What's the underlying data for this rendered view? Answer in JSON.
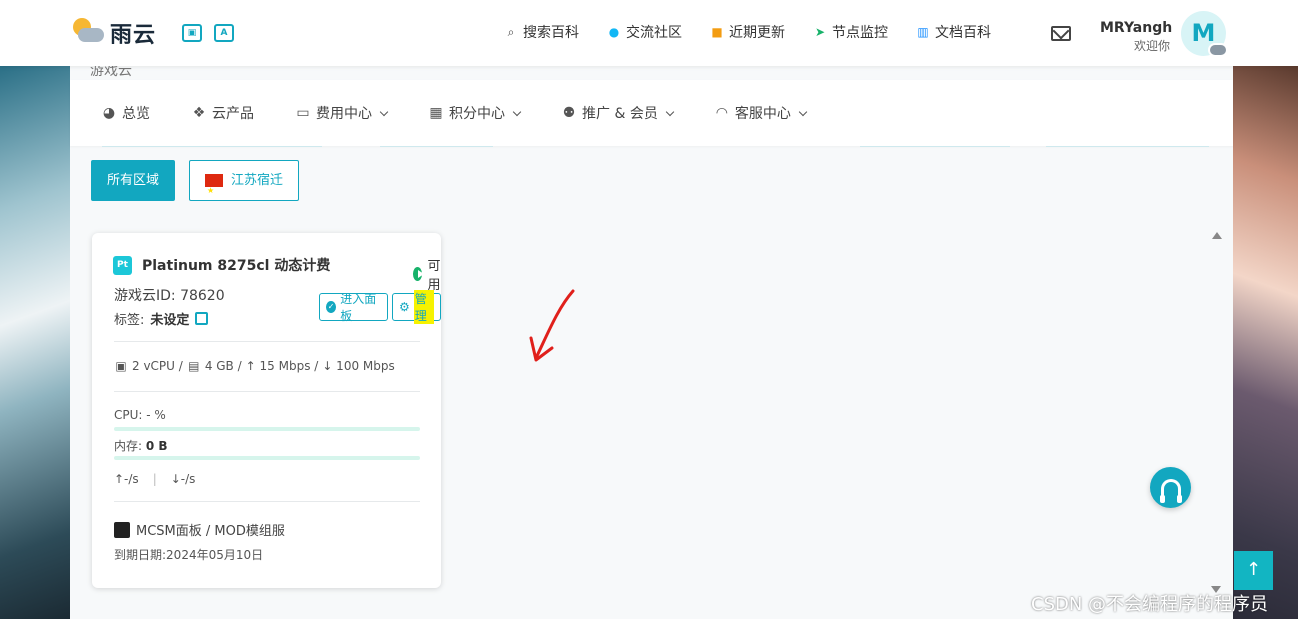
{
  "brand": {
    "name": "雨云"
  },
  "topnav": [
    {
      "label": "搜索百科",
      "icon": "search-icon"
    },
    {
      "label": "交流社区",
      "icon": "qq-icon"
    },
    {
      "label": "近期更新",
      "icon": "news-icon"
    },
    {
      "label": "节点监控",
      "icon": "send-icon"
    },
    {
      "label": "文档百科",
      "icon": "book-icon"
    }
  ],
  "user": {
    "name": "MRYangh",
    "welcome": "欢迎你",
    "avatar_letter": "M"
  },
  "crumb_hint": "游戏云",
  "subnav": [
    {
      "label": "总览"
    },
    {
      "label": "云产品"
    },
    {
      "label": "费用中心"
    },
    {
      "label": "积分中心"
    },
    {
      "label": "推广 & 会员"
    },
    {
      "label": "客服中心"
    }
  ],
  "regions": {
    "all": "所有区域",
    "jiangsu": "江苏宿迁"
  },
  "card": {
    "badge": "Pt",
    "title": "Platinum 8275cl 动态计费",
    "status": "可用",
    "id_text": "游戏云ID: 78620",
    "tag_label": "标签:",
    "tag_value": "未设定",
    "enter_panel": "进入面板",
    "manage": "管理",
    "cpu_spec": "2 vCPU /",
    "ram_spec": "4 GB /",
    "up_spec": "↑ 15 Mbps /",
    "down_spec": "↓ 100 Mbps",
    "cpu_label": "CPU:",
    "cpu_value": "- %",
    "mem_label": "内存:",
    "mem_value": "0 B",
    "net_up": "↑-/s",
    "net_sep": "|",
    "net_down": "↓-/s",
    "os": "MCSM面板 / MOD模组服",
    "expire": "到期日期:2024年05月10日",
    "cpu_usage_percent": 0,
    "mem_usage_percent": 0
  },
  "watermark": "CSDN @不会编程序的程序员",
  "colors": {
    "accent": "#12a7c0",
    "success": "#17b26a",
    "highlight": "#f6f200",
    "annotation": "#e0201b"
  }
}
